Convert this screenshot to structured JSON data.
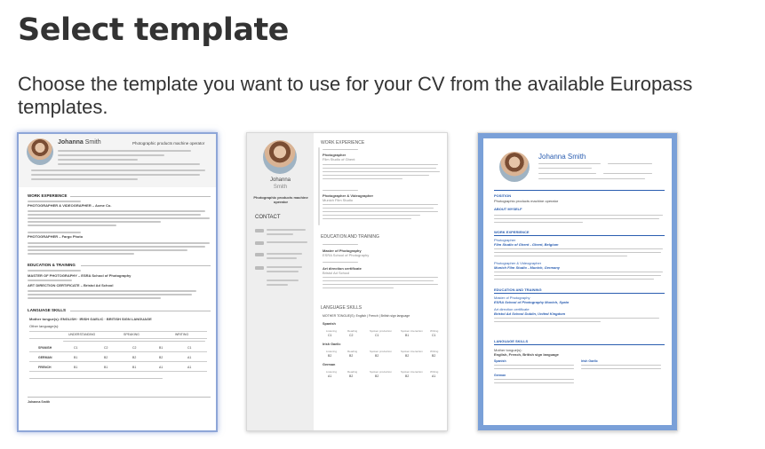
{
  "header": {
    "title": "Select template",
    "subtitle": "Choose the template you want to use for your CV from the available Europass templates."
  },
  "templates": [
    {
      "name_first": "Johanna",
      "name_last": "Smith",
      "job": "Photographic products machine operator",
      "work_experience": "WORK EXPERIENCE",
      "job1": "PHOTOGRAPHER & VIDEOGRAPHER – Acme Co.",
      "job2": "PHOTOGRAPHER – Fargo Photo",
      "education": "EDUCATION & TRAINING",
      "edu1": "MASTER OF PHOTOGRAPHY – ESRA School of Photography",
      "edu2": "ART DIRECTION CERTIFICATE – Bristol Ad School",
      "languages": "LANGUAGE SKILLS",
      "mother_tongue": "Mother tongue(s): ENGLISH · IRISH GAELIC · BRITISH SIGN LANGUAGE",
      "other_languages": "Other language(s):",
      "lang_headers": [
        "UNDERSTANDING",
        "SPEAKING",
        "WRITING"
      ],
      "lang_rows": [
        {
          "lang": "SPANISH",
          "a": "C1",
          "b": "C2",
          "c": "C2",
          "d": "B1",
          "e": "C1"
        },
        {
          "lang": "GERMAN",
          "a": "B1",
          "b": "B2",
          "c": "B2",
          "d": "B2",
          "e": "A1"
        },
        {
          "lang": "FRENCH",
          "a": "B1",
          "b": "B1",
          "c": "B1",
          "d": "A1",
          "e": "A1"
        }
      ],
      "footer": "Johanna Smith"
    },
    {
      "name": "Johanna",
      "surname": "Smith",
      "job": "Photographic products machine operator",
      "contact": "CONTACT",
      "work_experience": "WORK EXPERIENCE",
      "job1": "Photographer",
      "job1_place": "Film Studio of Ghent",
      "job2": "Photographer & Videographer",
      "job2_place": "Munich Film Studio",
      "education": "EDUCATION AND TRAINING",
      "edu1": "Master of Photography",
      "edu1_place": "ESRA School of Photography",
      "edu2": "Art direction certificate",
      "edu2_place": "Bristol Ad School",
      "languages": "LANGUAGE SKILLS",
      "mother_tongue": "MOTHER TONGUE(S): English | French | British sign language",
      "lang_rows": [
        {
          "lang": "Spanish",
          "vals": [
            "C1",
            "C2",
            "C1",
            "B1",
            "C1"
          ]
        },
        {
          "lang": "Irish Gaelic",
          "vals": [
            "B2",
            "B2",
            "B2",
            "B2",
            "B2"
          ]
        },
        {
          "lang": "German",
          "vals": [
            "A1",
            "B2",
            "B2",
            "B2",
            "A1"
          ]
        }
      ],
      "lang_cols": [
        "Listening",
        "Reading",
        "Spoken production",
        "Spoken interaction",
        "Writing"
      ]
    },
    {
      "name": "Johanna Smith",
      "position_h": "POSITION",
      "position": "Photographic products machine operator",
      "about_h": "ABOUT MYSELF",
      "work_h": "WORK EXPERIENCE",
      "job1": "Photographer",
      "job1_place": "Film Studio of Ghent - Ghent, Belgium",
      "job2": "Photographer & Videographer",
      "job2_place": "Munich Film Studio - Munich, Germany",
      "edu_h": "EDUCATION AND TRAINING",
      "edu1": "Master of Photography",
      "edu1_place": "ESRA School of Photography Munich, Spain",
      "edu2": "Art direction certificate",
      "edu2_place": "Bristol Ad School Dublin, United Kingdom",
      "lang_h": "LANGUAGE SKILLS",
      "mother_tongue": "Mother tongue(s):",
      "mother_langs": "English, French, British sign language",
      "lang1": "Spanish",
      "lang2": "Irish Gaelic",
      "lang3": "German"
    }
  ]
}
